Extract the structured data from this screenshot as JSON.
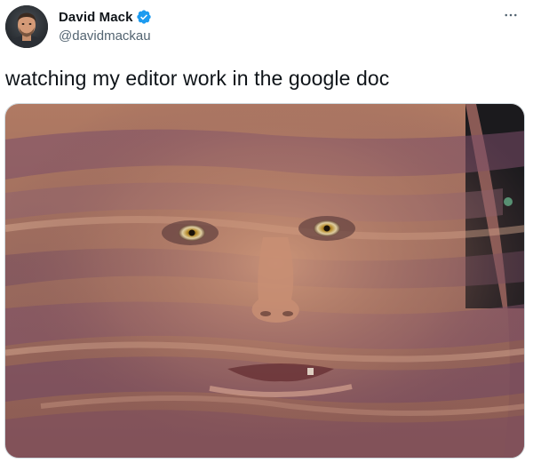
{
  "author": {
    "display_name": "David Mack",
    "handle": "@davidmackau",
    "verified": true,
    "avatar_icon": "profile-photo"
  },
  "tweet": {
    "text": "watching my editor work in the google doc"
  },
  "menu": {
    "more_icon": "more-horizontal-icon"
  },
  "media": {
    "kind": "photo",
    "icon": "meme-photo"
  },
  "colors": {
    "verified_blue": "#1d9bf0",
    "handle_gray": "#536471",
    "text": "#0f1419"
  }
}
